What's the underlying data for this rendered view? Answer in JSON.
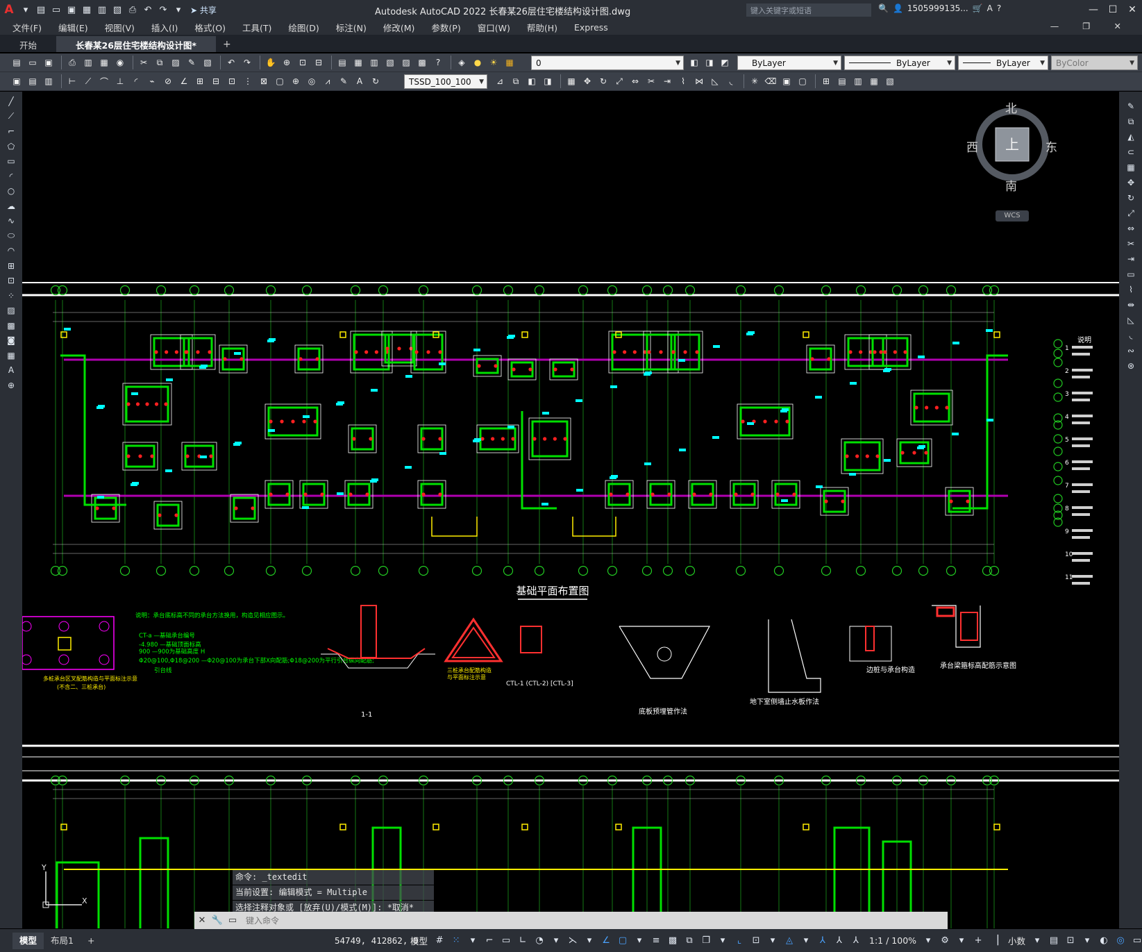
{
  "window": {
    "title": "Autodesk AutoCAD 2022    长春某26层住宅楼结构设计图.dwg",
    "share_label": "共享",
    "search_placeholder": "键入关键字或短语",
    "user": "1505999135..."
  },
  "menu": [
    "文件(F)",
    "编辑(E)",
    "视图(V)",
    "插入(I)",
    "格式(O)",
    "工具(T)",
    "绘图(D)",
    "标注(N)",
    "修改(M)",
    "参数(P)",
    "窗口(W)",
    "帮助(H)",
    "Express"
  ],
  "tabs": {
    "start": "开始",
    "doc": "长春某26层住宅楼结构设计图*"
  },
  "properties": {
    "layer": "0",
    "color": "ByLayer",
    "linetype": "ByLayer",
    "lineweight": "ByLayer",
    "plotstyle": "ByColor",
    "style": "TSSD_100_100"
  },
  "viewcube": {
    "north": "北",
    "south": "南",
    "east": "东",
    "west": "西",
    "top": "上",
    "wcs": "WCS"
  },
  "drawing": {
    "plan_title": "基础平面布置图",
    "notes_title": "说明",
    "details": [
      "多桩承台区叉配筋构造与平面标注示意",
      "(不含二、三桩承台)",
      "三桩承台配筋构造",
      "与平面标注示意",
      "CTL-1 (CTL-2) [CTL-3]",
      "底板预埋管作法",
      "地下室侧墙止水板作法",
      "边桩与承台构造",
      "承台梁箍标高配筋示意图",
      "1-1"
    ],
    "legend": [
      "说明：承台底标高不同的承台方法换用，构造见相应图示。",
      "CT-a —基础承台编号",
      "-4.980 —基础顶面标高",
      "900 —900为基础高度 H",
      "Φ20@100,Φ18@200 —Φ20@100为承台下部X向配筋;Φ18@200为平行引台纵向配筋;",
      "引台线"
    ],
    "notes_numbers": [
      "1",
      "2",
      "3",
      "4",
      "5",
      "6",
      "7",
      "8",
      "9",
      "10",
      "11"
    ]
  },
  "command": {
    "history": [
      "命令: _textedit",
      "当前设置: 编辑模式 = Multiple",
      "选择注释对象或 [放弃(U)/模式(M)]: *取消*"
    ],
    "placeholder": "键入命令"
  },
  "status": {
    "layout_tabs": [
      "模型",
      "布局1"
    ],
    "coords": "54749, 412862, 0",
    "model": "模型",
    "scale": "1:1 / 100%",
    "units": "小数"
  },
  "colors": {
    "accent": "#4aa3ff",
    "wall": "#00e000",
    "column": "#ff2020",
    "dim": "#00ffff",
    "beam": "#b000b0",
    "grid": "#22cc22"
  }
}
